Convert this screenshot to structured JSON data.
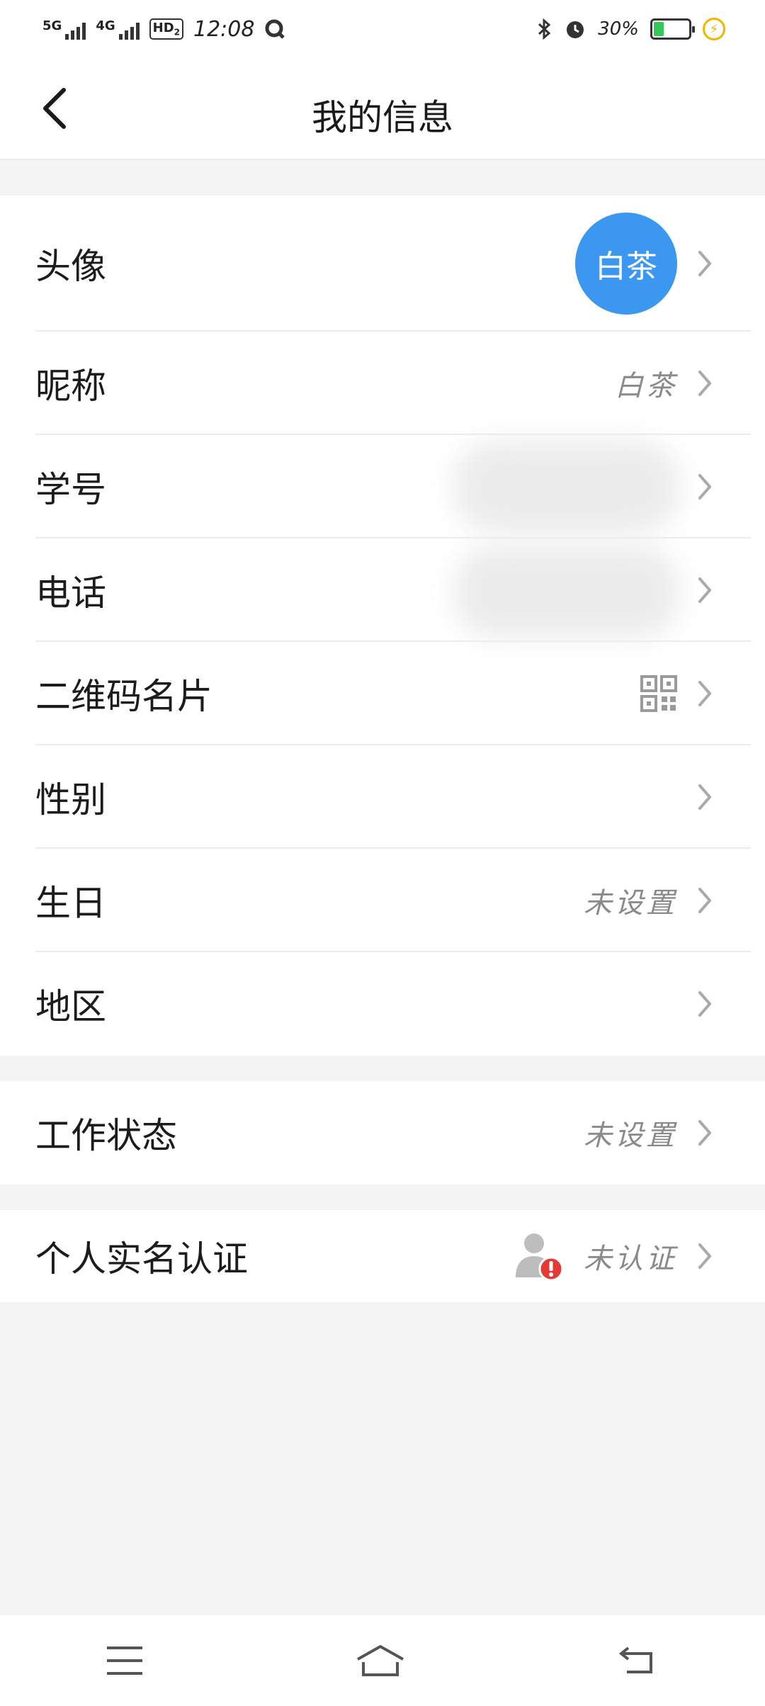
{
  "status_bar": {
    "signal_1": "5G",
    "signal_2": "4G",
    "hd_label": "HD",
    "hd_sub": "2",
    "time": "12:08",
    "battery": "30%"
  },
  "header": {
    "title": "我的信息"
  },
  "profile": {
    "avatar": {
      "label": "头像",
      "avatar_text": "白茶"
    },
    "nickname": {
      "label": "昵称",
      "value": "白茶"
    },
    "student_id": {
      "label": "学号"
    },
    "phone": {
      "label": "电话"
    },
    "qr_card": {
      "label": "二维码名片"
    },
    "gender": {
      "label": "性别"
    },
    "birthday": {
      "label": "生日",
      "value": "未设置"
    },
    "region": {
      "label": "地区"
    }
  },
  "work": {
    "status": {
      "label": "工作状态",
      "value": "未设置"
    }
  },
  "verification": {
    "realname": {
      "label": "个人实名认证",
      "value": "未认证"
    }
  },
  "colors": {
    "accent": "#3c97f0",
    "alert": "#e53935",
    "background": "#f4f4f4"
  },
  "icons": [
    "back-arrow-icon",
    "chevron-right-icon",
    "qr-code-icon",
    "user-unverified-icon",
    "menu-icon",
    "home-icon",
    "back-nav-icon"
  ]
}
